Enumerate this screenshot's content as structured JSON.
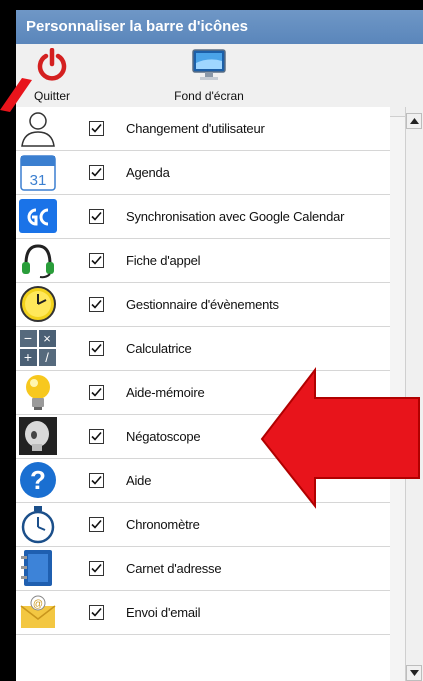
{
  "window": {
    "title": "Personnaliser la barre d'icônes"
  },
  "toolbar": {
    "quit_label": "Quitter",
    "wallpaper_label": "Fond d'écran"
  },
  "items": [
    {
      "label": "Changement d'utilisateur",
      "icon": "user-silhouette-icon",
      "checked": true
    },
    {
      "label": "Agenda",
      "icon": "calendar-icon",
      "icon_text": "31",
      "checked": true
    },
    {
      "label": "Synchronisation avec Google Calendar",
      "icon": "google-calendar-icon",
      "checked": true
    },
    {
      "label": "Fiche d'appel",
      "icon": "headset-icon",
      "checked": true
    },
    {
      "label": "Gestionnaire d'évènements",
      "icon": "clock-icon",
      "checked": true
    },
    {
      "label": "Calculatrice",
      "icon": "calculator-icon",
      "checked": true
    },
    {
      "label": "Aide-mémoire",
      "icon": "lightbulb-icon",
      "checked": true
    },
    {
      "label": "Négatoscope",
      "icon": "xray-skull-icon",
      "checked": true
    },
    {
      "label": "Aide",
      "icon": "help-question-icon",
      "checked": true
    },
    {
      "label": "Chronomètre",
      "icon": "stopwatch-icon",
      "checked": true
    },
    {
      "label": "Carnet d'adresse",
      "icon": "address-book-icon",
      "checked": true
    },
    {
      "label": "Envoi d'email",
      "icon": "email-icon",
      "checked": true
    }
  ],
  "colors": {
    "titlebar": "#5f8bc0",
    "arrow": "#e8141b"
  }
}
